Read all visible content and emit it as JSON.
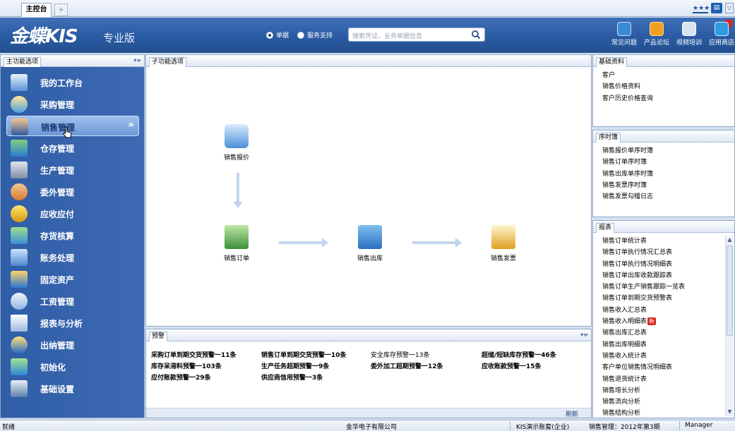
{
  "tabs": {
    "main_tab": "主控台",
    "add_tab": "+"
  },
  "header": {
    "logo": "金蝶KIS",
    "edition": "专业版",
    "radio_options": [
      "单据",
      "服务支持"
    ],
    "search_placeholder": "搜索凭证、业务单据信息",
    "quick_links": [
      "常见问题",
      "产品论坛",
      "视频培训",
      "应用商店"
    ]
  },
  "left_nav": {
    "title": "主功能选项",
    "items": [
      "我的工作台",
      "采购管理",
      "销售管理",
      "仓存管理",
      "生产管理",
      "委外管理",
      "应收应付",
      "存货核算",
      "账务处理",
      "固定资产",
      "工资管理",
      "报表与分析",
      "出纳管理",
      "初始化",
      "基础设置"
    ],
    "selected": "销售管理",
    "selected_chevron": "»"
  },
  "sub_function": {
    "title": "子功能选项",
    "nodes": [
      "销售报价",
      "销售订单",
      "销售出库",
      "销售发票"
    ]
  },
  "warnings": {
    "title": "预警",
    "items": [
      "采购订单到期交货预警一11条",
      "销售订单到期交货预警一10条",
      "安全库存预警一13条",
      "超储/短缺库存预警一46条",
      "库存呆滞料预警一103条",
      "生产任务超期预警一9条",
      "委外加工超期预警一12条",
      "应收账款预警一15条",
      "应付账款预警一29条",
      "供应商信用预警一3条"
    ],
    "refresh": "刷新"
  },
  "right_panels": {
    "basic": {
      "title": "基础资料",
      "items": [
        "客户",
        "销售价格资料",
        "客户历史价格查询"
      ]
    },
    "sequence": {
      "title": "序时簿",
      "items": [
        "销售报价单序时簿",
        "销售订单序时簿",
        "销售出库单序时簿",
        "销售发票序时簿",
        "销售发票勾稽日志"
      ]
    },
    "reports": {
      "title": "报表",
      "items": [
        "销售订单统计表",
        "销售订单执行情况汇总表",
        "销售订单执行情况明细表",
        "销售订单出库收款跟踪表",
        "销售订单生产销售跟踪一览表",
        "销售订单到期交货预警表",
        "销售收入汇总表",
        "销售收入明细表",
        "销售出库汇总表",
        "销售出库明细表",
        "销售收入统计表",
        "客户单位销售情况明细表",
        "销售退货统计表",
        "销售增长分析",
        "销售流向分析",
        "销售结构分析"
      ],
      "new_badge": "新"
    }
  },
  "status_bar": {
    "left": "就绪",
    "company": "金华电子有限公司",
    "account": "KIS演示账套(企业)",
    "period": "销售管理：2012年第3期",
    "user": "Manager"
  },
  "colors": {
    "nav_bg": "#2f5da6",
    "header_bg": "#2a5aa2",
    "accent": "#1f4fa0",
    "badge_red": "#d9221b"
  }
}
